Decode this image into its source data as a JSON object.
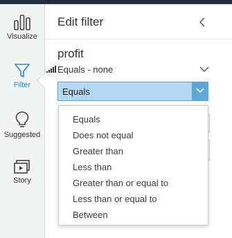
{
  "rail": {
    "items": [
      {
        "label": "Visualize",
        "icon": "bar-chart-icon"
      },
      {
        "label": "Filter",
        "icon": "funnel-icon",
        "active": true
      },
      {
        "label": "Suggested",
        "icon": "lightbulb-icon"
      },
      {
        "label": "Story",
        "icon": "story-icon"
      }
    ]
  },
  "panel": {
    "title": "Edit filter",
    "field_name": "profit",
    "field_summary": "Equals - none",
    "select_value": "Equals",
    "options": [
      "Equals",
      "Does not equal",
      "Greater than",
      "Less than",
      "Greater than or equal to",
      "Less than or equal to",
      "Between"
    ]
  },
  "colors": {
    "accent": "#2e8ccd",
    "select_bg": "#b4d8f2",
    "select_border": "#5aa7dc",
    "topbar": "#232f3e"
  }
}
